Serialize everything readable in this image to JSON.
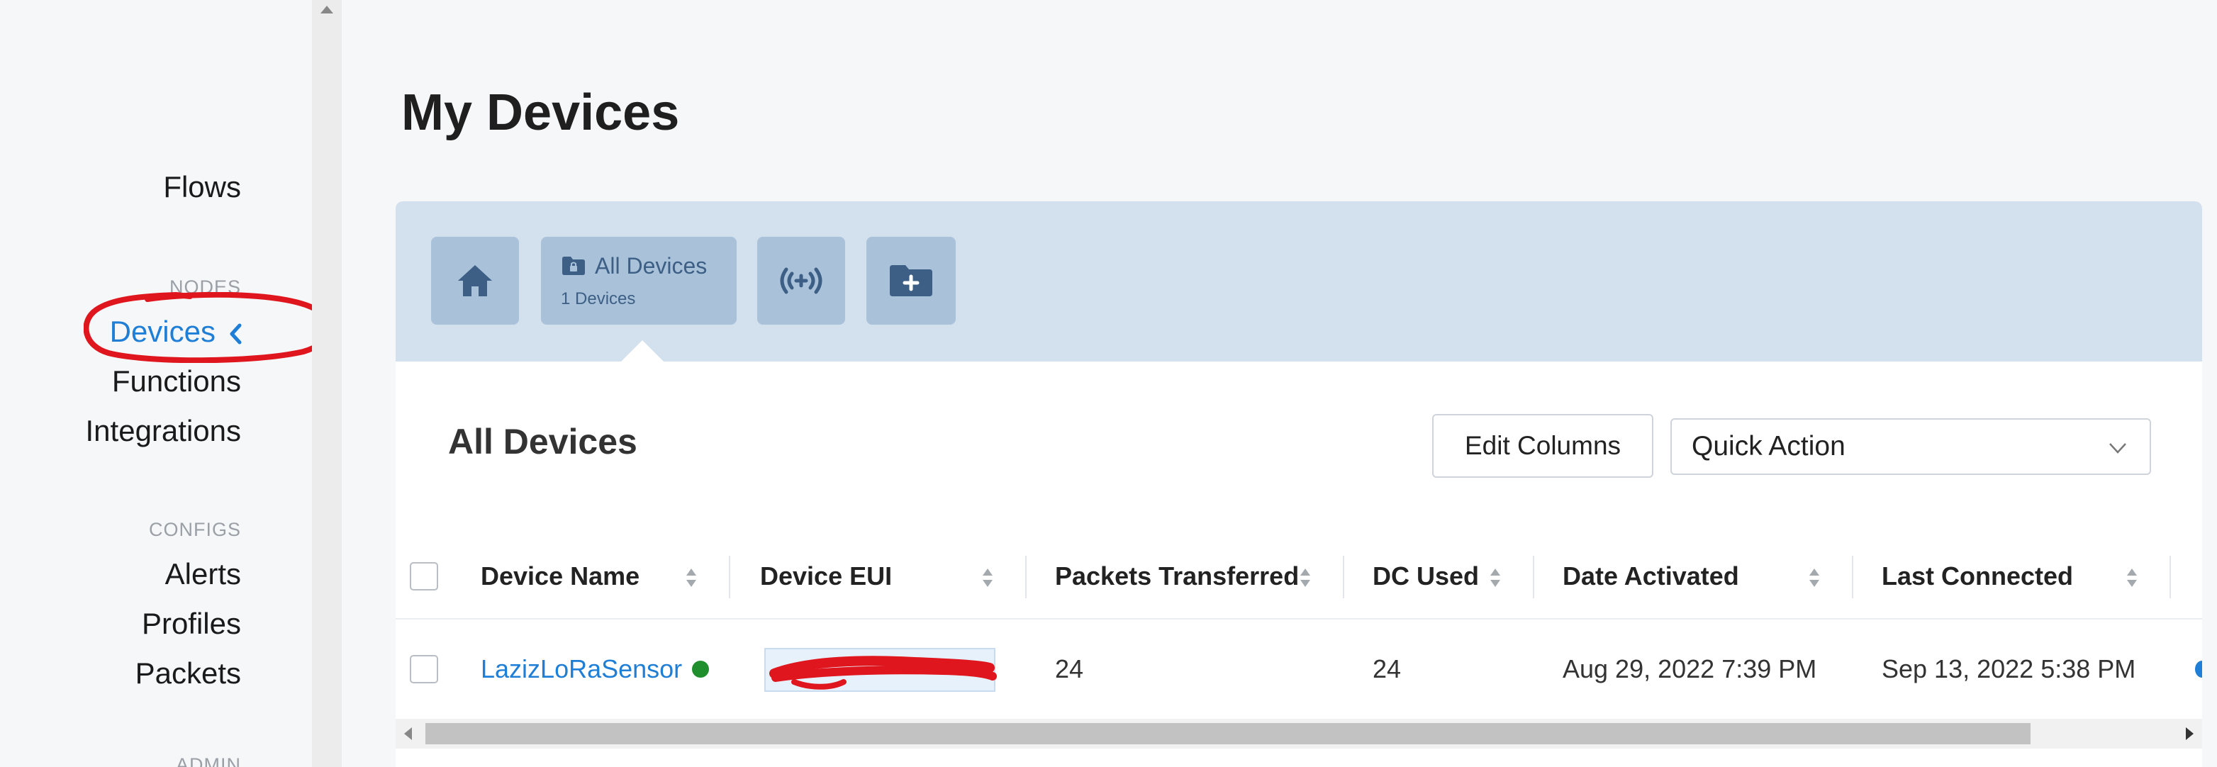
{
  "sidebar": {
    "flows_label": "Flows",
    "nodes_header": "NODES",
    "devices_label": "Devices",
    "functions_label": "Functions",
    "integrations_label": "Integrations",
    "configs_header": "CONFIGS",
    "alerts_label": "Alerts",
    "profiles_label": "Profiles",
    "packets_label": "Packets",
    "admin_header": "ADMIN",
    "active_color": "#1f7ed6"
  },
  "page": {
    "title": "My Devices"
  },
  "toolbar": {
    "home_icon": "home-icon",
    "all_devices_label": "All Devices",
    "all_devices_count": "1 Devices",
    "radio_icon": "signal-icon",
    "folder_icon": "add-folder-icon",
    "background": "#d3e1ee",
    "button_color": "#a9c2da"
  },
  "section": {
    "title": "All Devices",
    "edit_columns_label": "Edit Columns",
    "quick_action_label": "Quick Action"
  },
  "table": {
    "columns": [
      "Device Name",
      "Device EUI",
      "Packets Transferred",
      "DC Used",
      "Date Activated",
      "Last Connected"
    ],
    "rows": [
      {
        "device_name": "LazizLoRaSensor",
        "status": "online",
        "device_eui": "",
        "packets_transferred": "24",
        "dc_used": "24",
        "date_activated": "Aug 29, 2022 7:39 PM",
        "last_connected": "Sep 13, 2022 5:38 PM"
      }
    ]
  },
  "annotation": {
    "color": "#e0161e",
    "target": "Devices"
  }
}
